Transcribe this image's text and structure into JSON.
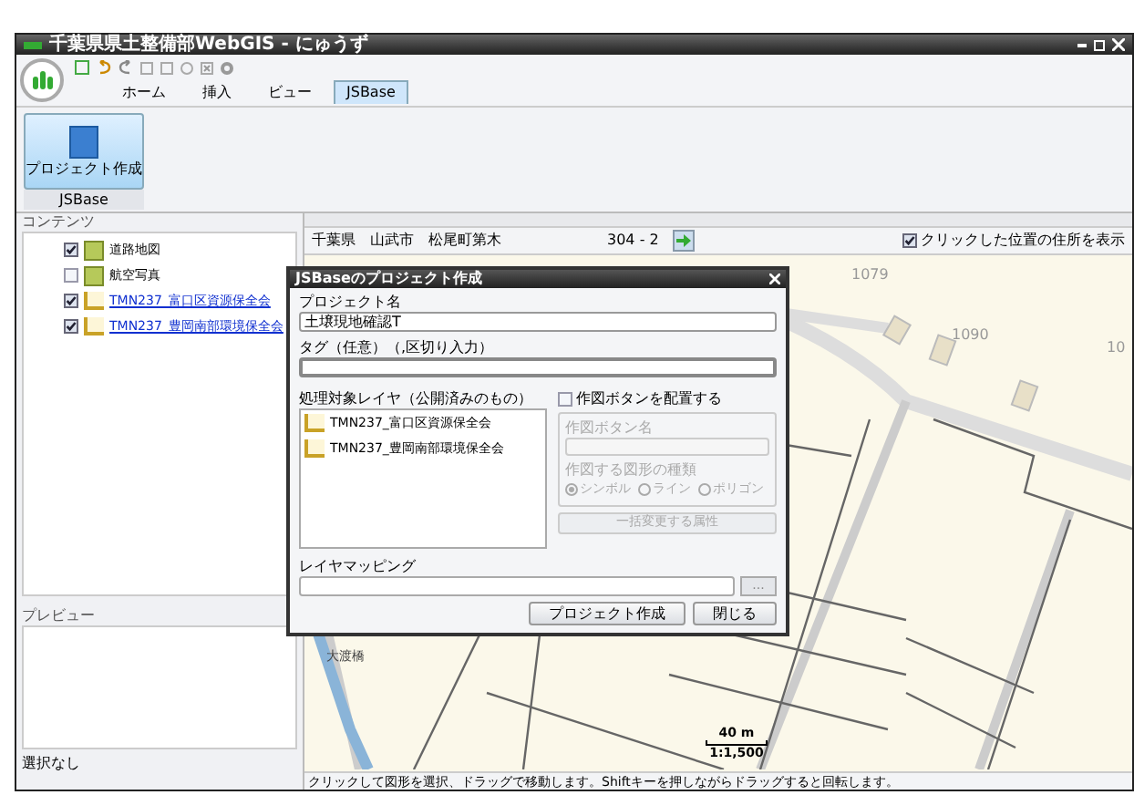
{
  "window": {
    "title": "千葉県県土整備部WebGIS - にゅうず"
  },
  "tabs": [
    {
      "label": "ホーム",
      "selected": false
    },
    {
      "label": "挿入",
      "selected": false
    },
    {
      "label": "ビュー",
      "selected": false
    },
    {
      "label": "JSBase",
      "selected": true
    }
  ],
  "ribbon": {
    "button": "プロジェクト作成",
    "group": "JSBase"
  },
  "contents": {
    "title": "コンテンツ",
    "layers": [
      {
        "name": "道路地図",
        "checked": true,
        "kind": "base",
        "link": false
      },
      {
        "name": "航空写真",
        "checked": false,
        "kind": "base",
        "link": false
      },
      {
        "name": "TMN237_富口区資源保全会",
        "checked": true,
        "kind": "edit",
        "link": true
      },
      {
        "name": "TMN237_豊岡南部環境保全会",
        "checked": true,
        "kind": "edit",
        "link": true
      }
    ]
  },
  "preview": {
    "title": "プレビュー",
    "status": "選択なし"
  },
  "address": {
    "parts": [
      "千葉県",
      "山武市",
      "松尾町第木"
    ],
    "number": "304 - 2",
    "option": {
      "label": "クリックした位置の住所を表示",
      "checked": true
    }
  },
  "dialog": {
    "title": "JSBaseのプロジェクト作成",
    "name_label": "プロジェクト名",
    "name_value": "土壌現地確認T",
    "tag_label": "タグ（任意）（,区切り入力）",
    "layers_label": "処理対象レイヤ（公開済みのもの）",
    "layers": [
      "TMN237_富口区資源保全会",
      "TMN237_豊岡南部環境保全会"
    ],
    "draw_option": {
      "label": "作図ボタンを配置する",
      "checked": false
    },
    "draw_name_label": "作図ボタン名",
    "shape_label": "作図する図形の種類",
    "shapes": [
      {
        "label": "シンボル",
        "selected": true
      },
      {
        "label": "ライン",
        "selected": false
      },
      {
        "label": "ポリゴン",
        "selected": false
      }
    ],
    "attr_button": "一括変更する属性",
    "mapping_label": "レイヤマッピング",
    "browse_button": "...",
    "buttons": [
      "プロジェクト作成",
      "閉じる"
    ]
  },
  "map": {
    "labels": [
      "1079",
      "1090",
      "10"
    ],
    "place": "大渡橋",
    "scale": "40 m",
    "ratio": "1:1,500"
  },
  "status_bar": "クリックして図形を選択、ドラッグで移動します。Shiftキーを押しながらドラッグすると回転します。"
}
